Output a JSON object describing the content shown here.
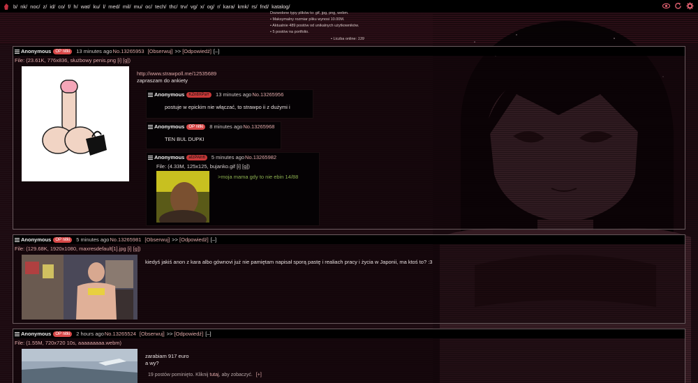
{
  "nav": {
    "boards": [
      "b/",
      "nk/",
      "noc/",
      "z/",
      "id/",
      "co/",
      "f/",
      "h/",
      "wat/",
      "ku/",
      "l/",
      "med/",
      "mil/",
      "mu/",
      "oc/",
      "tech/",
      "thc/",
      "trv/",
      "vg/",
      "x/",
      "og/",
      "r/",
      "kara/",
      "kmk/",
      "rs/",
      "fnd/",
      "katalog/"
    ],
    "icons": [
      "eye-icon",
      "refresh-icon",
      "gear-icon"
    ]
  },
  "header": {
    "info": [
      "Dozwolone typy plików to: gif, jpg, png, webm.",
      "• Maksymalny rozmiar pliku wynosi 10.00M.",
      "• Aktualnie 489 postów od unikalnych użytkowników.",
      "• 5 postów na portfolio."
    ],
    "online_label": "• Liczba online:",
    "online_count": "139"
  },
  "threads": [
    {
      "name": "Anonymous",
      "badge": "OP nitki",
      "time": "13 minutes ago",
      "no": "No.13265953",
      "watch": "[Obserwuj]",
      "arrows": ">>",
      "reply": "[Odpowiedź]",
      "collapse": "[–]",
      "file_label": "File:",
      "file_info": "(23.61K, 776x836, służbowy penis.png",
      "file_links": "[i] [g])",
      "text_link": "http://www.strawpoll.me/12535689",
      "text": "zapraszam do ankiety",
      "replies": [
        {
          "name": "Anonymous",
          "badge": "KZn8XPaY",
          "time": "13 minutes ago",
          "no": "No.13265956",
          "text": "postuje w epickim nie włączać, to strawpo ii z dużymi i"
        },
        {
          "name": "Anonymous",
          "badge": "OP nitki",
          "time": "8 minutes ago",
          "no": "No.13265968",
          "text": "TEN BUL DUPKI"
        },
        {
          "name": "Anonymous",
          "badge": "afzPAln6",
          "time": "5 minutes ago",
          "no": "No.13265982",
          "file_label": "File:",
          "file_info": "(4.33M, 125x125, bujanko.gif",
          "file_links": "[i] [g])",
          "text": ">moja mama gdy to nie ebin 14/88"
        }
      ]
    },
    {
      "name": "Anonymous",
      "badge": "OP nitki",
      "time": "5 minutes ago",
      "no": "No.13265981",
      "watch": "[Obserwuj]",
      "arrows": ">>",
      "reply": "[Odpowiedź]",
      "collapse": "[–]",
      "file_label": "File:",
      "file_info": "(129.68K, 1920x1080, maxresdefault[1].jpg",
      "file_links": "[i] [g])",
      "text": "kiedyś jakiś anon z kara albo gównovi już nie pamiętam napisał sporą pastę i realiach pracy i życia w Japonii, ma ktoś to? :3"
    },
    {
      "name": "Anonymous",
      "badge": "OP nitki",
      "time": "2 hours ago",
      "no": "No.13265524",
      "watch": "[Obserwuj]",
      "arrows": ">>",
      "reply": "[Odpowiedź]",
      "collapse": "[–]",
      "file_label": "File:",
      "file_info": "(1.55M, 720x720 10s, aaaaaaaaa.webm)",
      "text": "zarabiam 917 euro",
      "text2": "a wy?",
      "omitted_pre": "19 postów pominięto. Kliknij",
      "omitted_here": "tutaj",
      "omitted_post": ", aby zobaczyć.",
      "omitted_expand": "[+]"
    }
  ],
  "colors": {
    "accent": "#e0a8a8",
    "badge": "#d84848",
    "greentext": "#8cb050",
    "background": "#1c0a10"
  }
}
